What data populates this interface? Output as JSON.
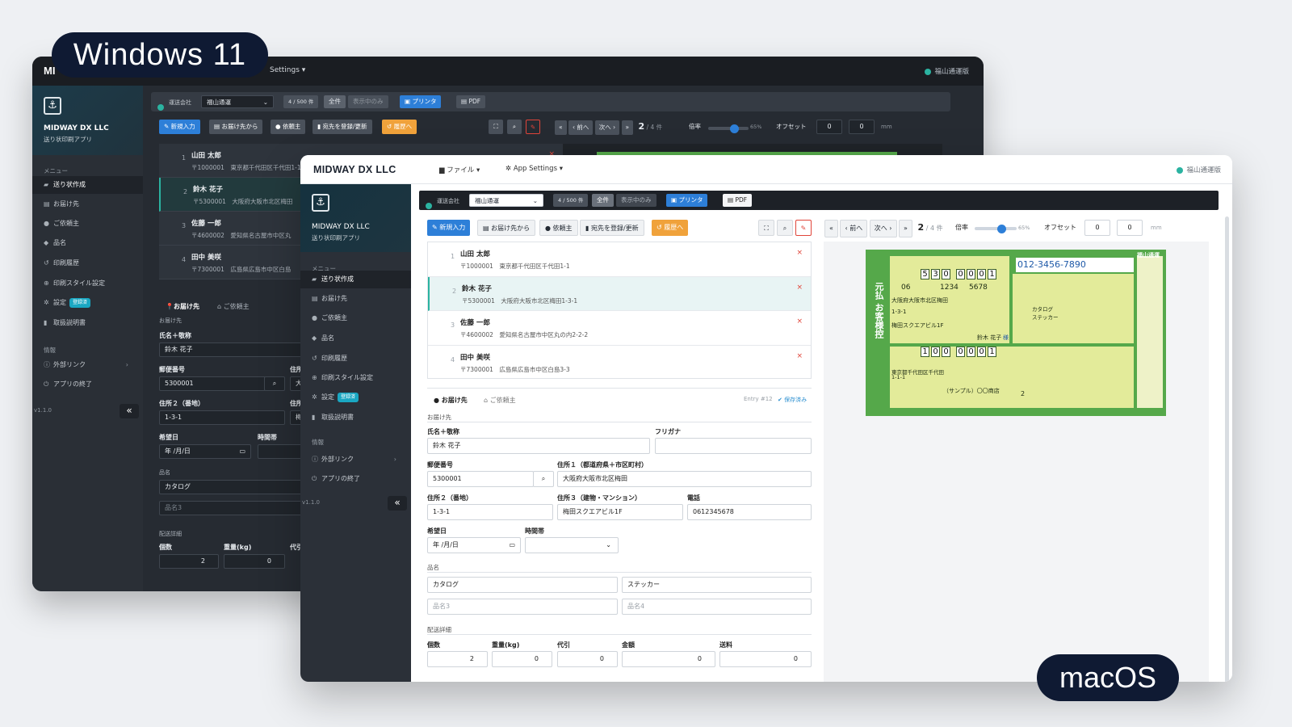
{
  "labels": {
    "windows": "Windows 11",
    "macos": "macOS"
  },
  "app": {
    "brand": "MIDWAY DX LLC",
    "brand_short_win": "MI",
    "subtitle": "送り状印刷アプリ",
    "file_menu": "ファイル",
    "settings_menu": "App Settings",
    "settings_menu_win": "Settings",
    "carrier_status": "福山通運版",
    "version": "v1.1.0"
  },
  "sidebar": {
    "menu_header": "メニュー",
    "info_header": "情報",
    "items": [
      {
        "label": "送り状作成",
        "icon": "truck-icon"
      },
      {
        "label": "お届け先",
        "icon": "address-book-icon"
      },
      {
        "label": "ご依頼主",
        "icon": "user-icon"
      },
      {
        "label": "品名",
        "icon": "tag-icon"
      },
      {
        "label": "印刷履歴",
        "icon": "history-icon"
      },
      {
        "label": "印刷スタイル設定",
        "icon": "crosshair-icon"
      },
      {
        "label": "設定",
        "icon": "gear-icon",
        "badge": "登録済"
      },
      {
        "label": "取扱説明書",
        "icon": "book-icon"
      }
    ],
    "info_items": [
      {
        "label": "外部リンク",
        "icon": "info-icon"
      },
      {
        "label": "アプリの終了",
        "icon": "power-icon"
      }
    ],
    "collapse": "«"
  },
  "toolbar": {
    "carrier_label": "運送会社",
    "carrier_value": "福山通運",
    "count": "4 / 500 件",
    "filter_all": "全件",
    "filter_visible": "表示中のみ",
    "printer": "プリンタ",
    "pdf": "PDF"
  },
  "actions": {
    "new": "新規入力",
    "from_dest": "お届け先から",
    "sender": "依頼主",
    "register_dest": "宛先を登録/更新",
    "history": "履歴へ"
  },
  "nav": {
    "first": "«",
    "prev": "‹ 前へ",
    "next": "次へ ›",
    "last": "»",
    "page": "2",
    "total": "/ 4 件",
    "zoom_label": "倍率",
    "zoom_value": "65%",
    "zoom_level": 0.65,
    "offset_label": "オフセット",
    "offset_x": "0",
    "offset_y": "0",
    "unit": "mm"
  },
  "records": [
    {
      "no": "1",
      "name": "山田 太郎",
      "address": "〒1000001　東京都千代田区千代田1-1"
    },
    {
      "no": "2",
      "name": "鈴木 花子",
      "address": "〒5300001　大阪府大阪市北区梅田1-3-1"
    },
    {
      "no": "3",
      "name": "佐藤 一郎",
      "address": "〒4600002　愛知県名古屋市中区丸の内2-2-2"
    },
    {
      "no": "4",
      "name": "田中 美咲",
      "address": "〒7300001　広島県広島市中区白島3-3"
    }
  ],
  "records_win": [
    {
      "no": "1",
      "name": "山田 太郎",
      "address": "〒1000001　東京都千代田区千代田1-1"
    },
    {
      "no": "2",
      "name": "鈴木 花子",
      "address": "〒5300001　大阪府大阪市北区梅田"
    },
    {
      "no": "3",
      "name": "佐藤 一郎",
      "address": "〒4600002　愛知県名古屋市中区丸"
    },
    {
      "no": "4",
      "name": "田中 美咲",
      "address": "〒7300001　広島県広島市中区白島"
    }
  ],
  "form": {
    "tab_dest": "お届け先",
    "tab_sender": "ご依頼主",
    "entry": "Entry #12",
    "saved": "保存済み",
    "section_dest": "お届け先",
    "name_label": "氏名＋敬称",
    "name_value": "鈴木 花子",
    "kana_label": "フリガナ",
    "zip_label": "郵便番号",
    "zip_value": "5300001",
    "addr1_label": "住所１（都道府県＋市区町村）",
    "addr1_value": "大阪府大阪市北区梅田",
    "addr2_label": "住所２（番地）",
    "addr2_value": "1-3-1",
    "addr3_label": "住所３（建物・マンション）",
    "addr3_value": "梅田スクエアビル1F",
    "tel_label": "電話",
    "tel_value": "0612345678",
    "date_label": "希望日",
    "date_value": "年 /月/日",
    "time_label": "時間帯",
    "item_section": "品名",
    "item1": "カタログ",
    "item2": "ステッカー",
    "item3_ph": "品名3",
    "item4_ph": "品名4",
    "detail_section": "配送詳細",
    "qty_label": "個数",
    "qty_value": "2",
    "weight_label": "重量(kg)",
    "weight_value": "0",
    "cod_label": "代引",
    "cod_value": "0",
    "amount_label": "金額",
    "amount_value": "0",
    "fee_label": "送料",
    "fee_value": "0",
    "win_addr1_short": "住所",
    "win_addr2_short": "大",
    "win_addr3_short": "梅",
    "win_cod_short": "代引"
  },
  "slip": {
    "phone": "012-3456-7890",
    "carrier": "福山通運",
    "zip_digits": [
      "5",
      "3",
      "0",
      "0",
      "0",
      "0",
      "1"
    ],
    "tel_area": "06",
    "tel_mid": "1234",
    "tel_last": "5678",
    "addr_line1": "大阪府大阪市北区梅田",
    "addr_line2": "1-3-1",
    "addr_line3": "梅田スクエアビル1F",
    "to_name": "鈴木 花子",
    "to_sama": "様",
    "items": "カタログ\nステッカー",
    "sender_zip_digits": [
      "1",
      "0",
      "0",
      "0",
      "0",
      "0",
      "1"
    ],
    "sender_addr1": "東京都千代田区千代田",
    "sender_addr2": "1-1-1",
    "sender_name": "（サンプル）〇〇商店",
    "qty": "2",
    "side_text": "元払 お客様控"
  }
}
